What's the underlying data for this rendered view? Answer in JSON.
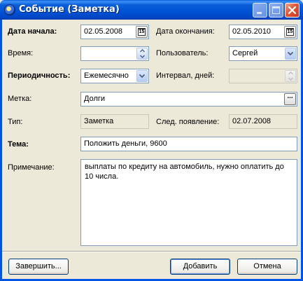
{
  "window": {
    "title": "Событие (Заметка)",
    "controls": [
      "minimize-icon",
      "maximize-icon",
      "close-icon"
    ]
  },
  "form": {
    "start_date_label": "Дата начала:",
    "start_date_value": "02.05.2008",
    "end_date_label": "Дата окончания:",
    "end_date_value": "02.05.2010",
    "calendar_button_text": "15",
    "time_label": "Время:",
    "time_value": "",
    "user_label": "Пользователь:",
    "user_value": "Сергей",
    "periodicity_label": "Периодичность:",
    "periodicity_value": "Ежемесячно",
    "interval_label": "Интервал, дней:",
    "interval_value": "",
    "tag_label": "Метка:",
    "tag_value": "Долги",
    "tag_browse_text": "...",
    "type_label": "Тип:",
    "type_value": "Заметка",
    "next_label": "След. появление:",
    "next_value": "02.07.2008",
    "subject_label": "Тема:",
    "subject_value": "Положить деньги, 9600",
    "note_label": "Примечание:",
    "note_value": "выплаты по кредиту на автомобиль, нужно оплатить до 10 числа."
  },
  "buttons": {
    "finish": "Завершить...",
    "add": "Добавить",
    "cancel": "Отмена"
  },
  "colors": {
    "titlebar": "#0a5fd8",
    "dialog_bg": "#ece9d8",
    "field_border": "#7f9db9",
    "button_border": "#003c74"
  }
}
